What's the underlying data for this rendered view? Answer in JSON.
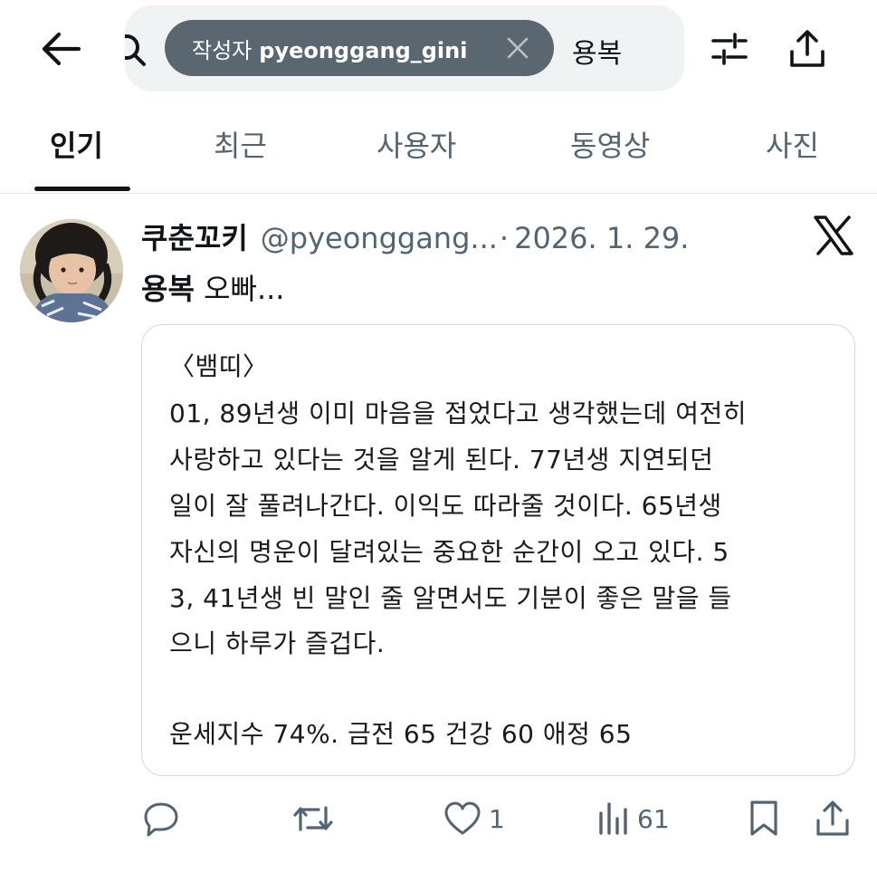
{
  "search": {
    "chip_prefix": "작성자",
    "chip_user": "pyeonggang_gini",
    "query": "용복"
  },
  "tabs": [
    {
      "label": "인기",
      "active": true
    },
    {
      "label": "최근",
      "active": false
    },
    {
      "label": "사용자",
      "active": false
    },
    {
      "label": "동영상",
      "active": false
    },
    {
      "label": "사진",
      "active": false
    }
  ],
  "post": {
    "display_name": "쿠춘꼬키",
    "handle": "@pyeonggang...",
    "separator": "·",
    "date": "2026. 1. 29.",
    "text_highlight": "용복",
    "text_rest": " 오빠...",
    "card_lines": [
      "〈뱀띠〉",
      "01, 89년생 이미 마음을 접었다고 생각했는데 여전히",
      " 사랑하고 있다는 것을 알게 된다. 77년생 지연되던",
      "일이 잘 풀려나간다. 이익도 따라줄 것이다. 65년생",
      "자신의 명운이 달려있는 중요한 순간이 오고 있다. 5",
      "3, 41년생 빈 말인 줄 알면서도 기분이 좋은 말을 들",
      "으니 하루가 즐겁다.",
      "운세지수 74%. 금전 65 건강 60 애정 65"
    ],
    "actions": {
      "reply_count": "",
      "repost_count": "",
      "like_count": "1",
      "views_count": "61"
    }
  },
  "colors": {
    "text_primary": "#0f1419",
    "text_secondary": "#536471",
    "search_bg": "#eff3f4",
    "chip_bg": "#5b6770",
    "border": "#cfd9de"
  },
  "icons": {
    "back": "arrow-left-icon",
    "search": "search-icon",
    "chip_close": "close-icon",
    "filter": "sliders-icon",
    "share": "share-icon",
    "brand": "x-logo-icon",
    "reply": "reply-icon",
    "repost": "repost-icon",
    "like": "heart-icon",
    "views": "views-icon",
    "bookmark": "bookmark-icon"
  }
}
